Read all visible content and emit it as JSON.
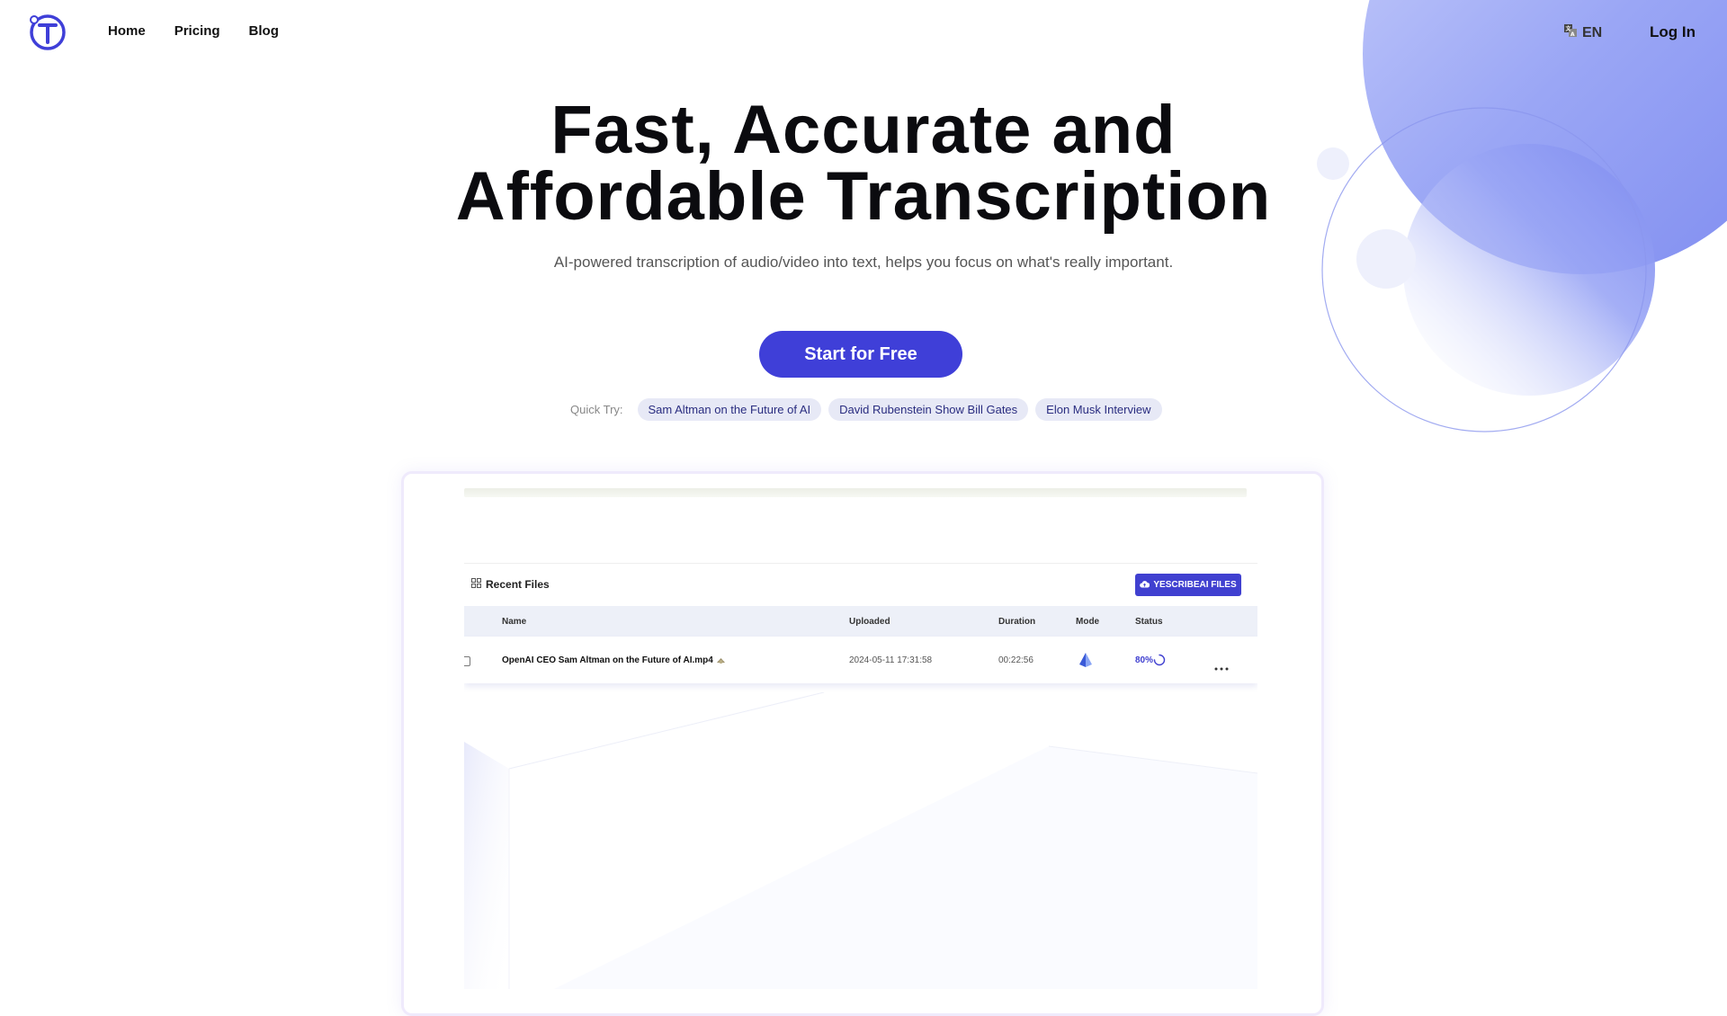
{
  "header": {
    "nav": [
      "Home",
      "Pricing",
      "Blog"
    ],
    "lang": "EN",
    "login": "Log In"
  },
  "hero": {
    "title_line1": "Fast, Accurate and",
    "title_line2": "Affordable Transcription",
    "subtitle": "AI-powered transcription of audio/video into text, helps you focus on what's really important.",
    "cta": "Start for Free",
    "quick_label": "Quick Try:",
    "quick_items": [
      "Sam Altman on the Future of AI",
      "David Rubenstein Show Bill Gates",
      "Elon Musk Interview"
    ]
  },
  "mock": {
    "recent_title": "Recent Files",
    "upload_label": "YESCRIBEAI FILES",
    "columns": [
      "Name",
      "Uploaded",
      "Duration",
      "Mode",
      "Status"
    ],
    "row": {
      "name": "OpenAI CEO Sam Altman on the Future of AI.mp4",
      "uploaded": "2024-05-11 17:31:58",
      "duration": "00:22:56",
      "status": "80%"
    }
  },
  "colors": {
    "accent": "#3f3fd8",
    "chip_bg": "#e7e9f6",
    "orb": "#8f9af2"
  }
}
